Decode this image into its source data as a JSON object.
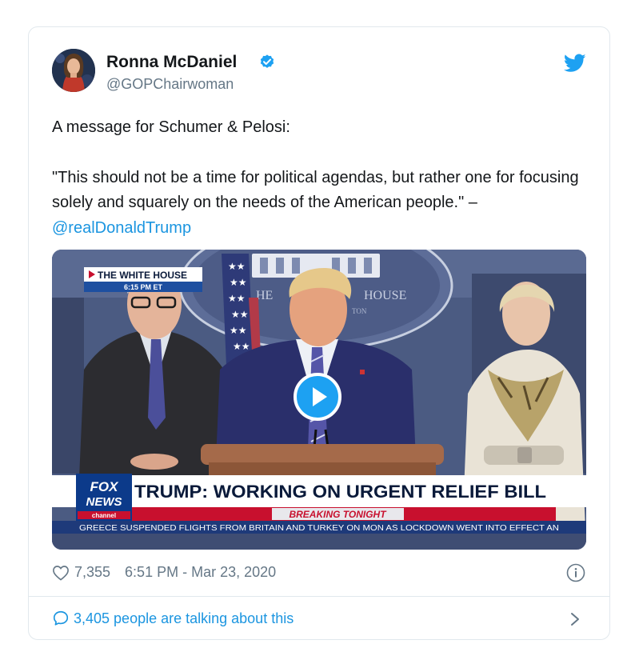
{
  "tweet": {
    "author_name": "Ronna McDaniel",
    "handle": "@GOPChairwoman",
    "text_line1": "A message for Schumer & Pelosi:",
    "quote": "\"This should not be a time for political agendas, but rather one for focusing solely and squarely on the needs of the American people.\" – ",
    "mention": "@realDonaldTrump",
    "likes": "7,355",
    "timestamp": "6:51 PM - Mar 23, 2020",
    "talking": "3,405 people are talking about this"
  },
  "video": {
    "location_tag": "THE WHITE HOUSE",
    "time_tag": "6:15 PM ET",
    "sign_left": "HE",
    "sign_right": "HOUSE",
    "sign_small": "TON",
    "network_line1": "FOX",
    "network_line2": "NEWS",
    "network_line3": "channel",
    "headline": "TRUMP: WORKING ON URGENT RELIEF BILL",
    "banner": "BREAKING TONIGHT",
    "ticker": "GREECE SUSPENDED FLIGHTS FROM BRITAIN AND TURKEY ON MON AS LOCKDOWN WENT INTO EFFECT AN"
  },
  "colors": {
    "twitter_blue": "#1da1f2",
    "link_blue": "#1b95e0",
    "muted_gray": "#657786",
    "breaking_red": "#c8102e"
  },
  "icons": {
    "verified": "verified-badge-icon",
    "bird": "twitter-bird-icon",
    "play": "play-icon",
    "heart": "heart-icon",
    "info": "info-icon",
    "bubble": "speech-bubble-icon",
    "chevron": "chevron-right-icon"
  }
}
